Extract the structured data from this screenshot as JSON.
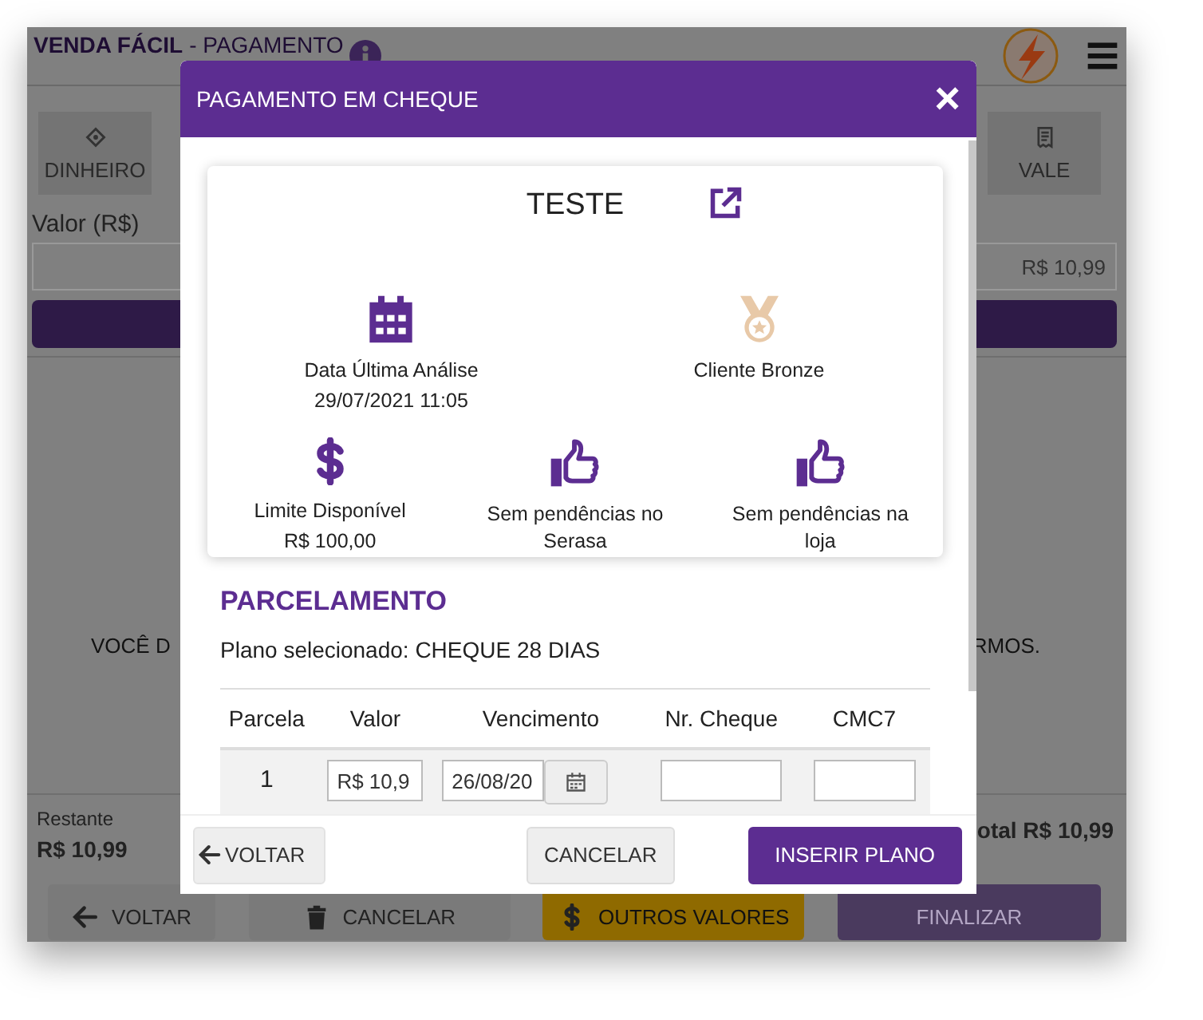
{
  "app": {
    "title": "VENDA FÁCIL",
    "subtitle": "- PAGAMENTO",
    "payment_tabs": [
      {
        "label": "DINHEIRO",
        "kind": "cash"
      },
      {
        "label": "VALE",
        "kind": "voucher"
      }
    ],
    "amount_label": "Valor (R$)",
    "amount_value": "R$ 10,99",
    "message_left": "VOCÊ D",
    "message_right": "RMOS.",
    "remaining_label": "Restante",
    "remaining_value": "R$ 10,99",
    "total_text": "otal R$ 10,99",
    "buttons": [
      {
        "label": "VOLTAR",
        "kind": "back"
      },
      {
        "label": "CANCELAR",
        "kind": "cancel"
      },
      {
        "label": "OUTROS VALORES",
        "kind": "other"
      },
      {
        "label": "FINALIZAR",
        "kind": "finish",
        "disabled": true
      }
    ]
  },
  "modal": {
    "title": "PAGAMENTO EM CHEQUE",
    "close": "×",
    "customer": {
      "name": "TESTE",
      "indicators": [
        {
          "kind": "calendar",
          "label": "Data Última Análise",
          "value": "29/07/2021 11:05"
        },
        {
          "kind": "medal",
          "label": "Cliente Bronze"
        },
        {
          "kind": "dollar",
          "label": "Limite Disponível",
          "value": "R$ 100,00"
        },
        {
          "kind": "thumbs",
          "label": "Sem pendências no Serasa"
        },
        {
          "kind": "thumbs",
          "label": "Sem pendências na loja"
        }
      ]
    },
    "section_title": "PARCELAMENTO",
    "plan_text": "Plano selecionado: CHEQUE 28 DIAS",
    "table": {
      "columns": [
        "Parcela",
        "Valor",
        "Vencimento",
        "Nr. Cheque",
        "CMC7"
      ],
      "rows": [
        {
          "parcela": "1",
          "valor": "R$ 10,9",
          "vencimento": "26/08/20",
          "cheque": "",
          "cmc7": ""
        }
      ]
    },
    "buttons": [
      {
        "label": "VOLTAR",
        "kind": "back"
      },
      {
        "label": "CANCELAR",
        "kind": "cancel"
      },
      {
        "label": "INSERIR PLANO",
        "kind": "primary"
      }
    ]
  }
}
